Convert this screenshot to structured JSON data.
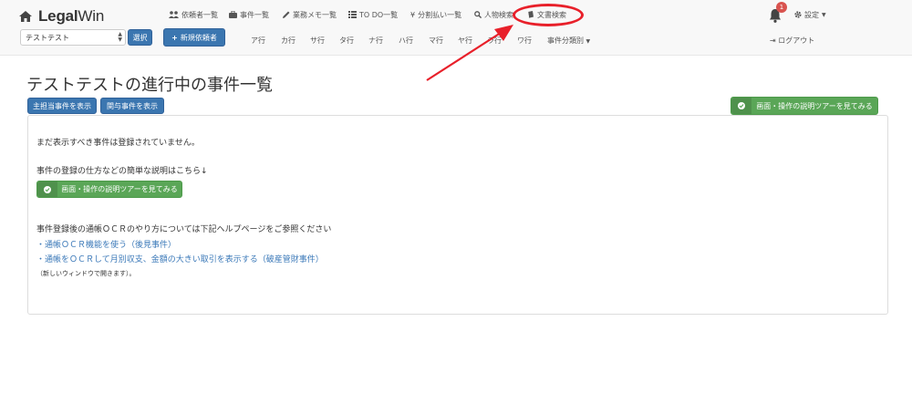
{
  "brand": {
    "name_bold": "Legal",
    "name_rest": "Win"
  },
  "nav": {
    "client_select": {
      "value": "テストテスト"
    },
    "select_button": "選択",
    "new_client_button": "新規依頼者",
    "top_menu": [
      {
        "label": "依頼者一覧",
        "icon": "users-icon"
      },
      {
        "label": "事件一覧",
        "icon": "briefcase-icon"
      },
      {
        "label": "業務メモ一覧",
        "icon": "pencil-icon"
      },
      {
        "label": "TO DO一覧",
        "icon": "list-icon"
      },
      {
        "label": "分割払い一覧",
        "icon": "yen-icon"
      },
      {
        "label": "人物検索",
        "icon": "search-icon"
      },
      {
        "label": "文書検索",
        "icon": "book-icon"
      }
    ],
    "kana_row": [
      "ア行",
      "カ行",
      "サ行",
      "タ行",
      "ナ行",
      "ハ行",
      "マ行",
      "ヤ行",
      "ラ行",
      "ワ行"
    ],
    "case_category": "事件分類別",
    "notification_count": "1",
    "settings": "設定",
    "logout": "ログアウト"
  },
  "page": {
    "title": "テストテストの進行中の事件一覧",
    "show_primary_button": "主担当事件を表示",
    "show_involved_button": "関与事件を表示",
    "tour_button": "画面・操作の説明ツアーを見てみる"
  },
  "panel": {
    "empty_message": "まだ表示すべき事件は登録されていません。",
    "howto_text": "事件の登録の仕方などの簡単な説明はこちら↓",
    "tour_button": "画面・操作の説明ツアーを見てみる",
    "ocr_intro": "事件登録後の通帳ＯＣＲのやり方については下記ヘルプページをご参照ください",
    "links": [
      "・通帳ＯＣＲ機能を使う（後見事件）",
      "・通帳をＯＣＲして月別収支、金額の大きい取引を表示する（破産管財事件）"
    ],
    "new_window_note": "（新しいウィンドウで開きます）。"
  },
  "colors": {
    "primary": "#3b76b0",
    "success": "#5aa657",
    "danger": "#d9534f",
    "annotation": "#e8202a",
    "link": "#3a78b8"
  }
}
